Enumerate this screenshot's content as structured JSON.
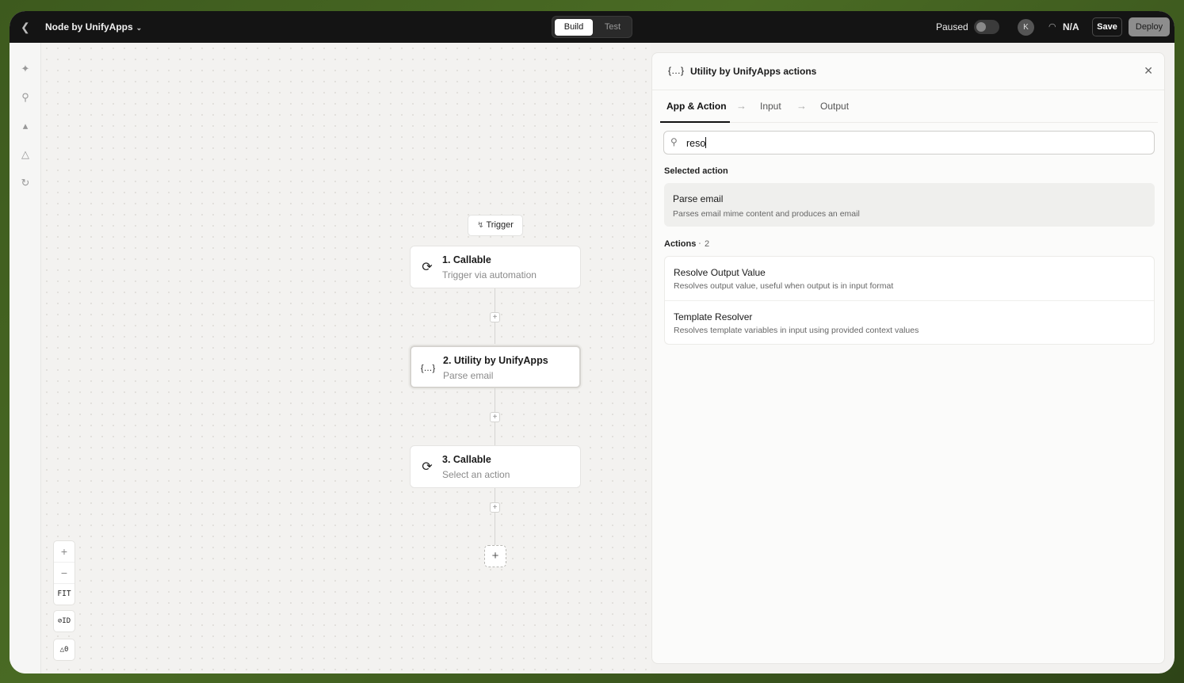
{
  "topbar": {
    "app_name": "Node by UnifyApps",
    "tabs": [
      "Build",
      "Test"
    ],
    "active_tab": "Build",
    "status_label": "Paused",
    "avatar_initial": "K",
    "metric_value": "N/A",
    "save_label": "Save",
    "deploy_label": "Deploy"
  },
  "rail": {
    "icons": [
      "sparkle-badge-icon",
      "search-icon",
      "graduation-cap-icon",
      "warning-triangle-icon",
      "history-icon"
    ]
  },
  "canvas": {
    "trigger_label": "Trigger",
    "nodes": [
      {
        "title": "1. Callable",
        "subtitle": "Trigger via automation",
        "icon": "sync-icon"
      },
      {
        "title": "2. Utility by UnifyApps",
        "subtitle": "Parse email",
        "icon": "braces-icon"
      },
      {
        "title": "3. Callable",
        "subtitle": "Select an action",
        "icon": "sync-icon"
      }
    ],
    "zoom": {
      "in": "+",
      "out": "−",
      "fit": "FIT"
    },
    "id_toggle": "ID",
    "warnings_count": "0"
  },
  "panel": {
    "icon_text": "{…}",
    "title": "Utility by UnifyApps actions",
    "tabs": [
      "App & Action",
      "Input",
      "Output"
    ],
    "search_value": "reso",
    "selected_section": "Selected action",
    "selected_action": {
      "title": "Parse email",
      "description": "Parses email mime content and produces an email"
    },
    "actions_section": "Actions",
    "actions_count": "2",
    "actions": [
      {
        "title": "Resolve Output Value",
        "description": "Resolves output value, useful when output is in input format"
      },
      {
        "title": "Template Resolver",
        "description": "Resolves template variables in input using provided context values"
      }
    ]
  }
}
